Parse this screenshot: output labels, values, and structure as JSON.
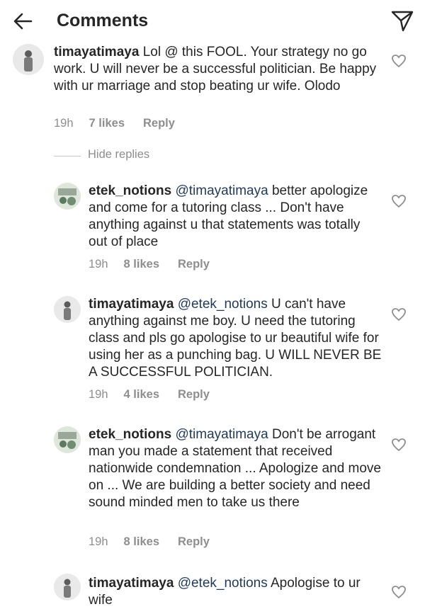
{
  "header": {
    "title": "Comments"
  },
  "hide_replies_label": "Hide replies",
  "comments": [
    {
      "username": "timayatimaya",
      "mention": "",
      "text": "Lol @ this FOOL. Your strategy no go work. U will never be a successful politician. Be happy with ur marriage and stop beating ur wife. Olodo",
      "time": "19h",
      "likes": "7 likes",
      "reply": "Reply"
    },
    {
      "username": "etek_notions",
      "mention": "@timayatimaya",
      "text": "better apologize and come for a tutoring class ... Don't have anything against u that statements was totally out of place",
      "time": "19h",
      "likes": "8 likes",
      "reply": "Reply"
    },
    {
      "username": "timayatimaya",
      "mention": "@etek_notions",
      "text": "U can't have anything against me boy. U  need the tutoring class and pls go apologise to ur beautiful wife for using her as a punching bag. U WILL NEVER BE A SUCCESSFUL POLITICIAN.",
      "time": "19h",
      "likes": "4 likes",
      "reply": "Reply"
    },
    {
      "username": "etek_notions",
      "mention": "@timayatimaya",
      "text": "Don't be arrogant man you made a statement that received nationwide condemnation ... Apologize and move on ... We are building a better society and need sound minded men to take us there",
      "time": "19h",
      "likes": "8 likes",
      "reply": "Reply"
    },
    {
      "username": "timayatimaya",
      "mention": "@etek_notions",
      "text": "Apologise to ur wife",
      "time": "",
      "likes": "",
      "reply": ""
    }
  ]
}
